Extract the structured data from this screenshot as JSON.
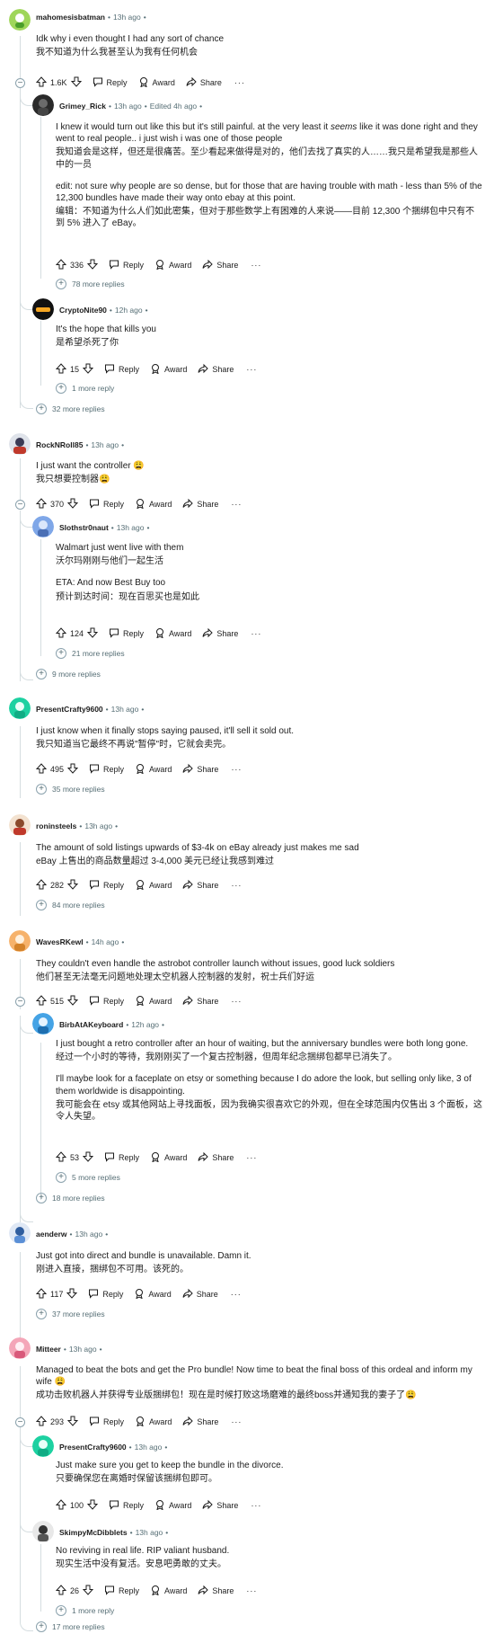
{
  "labels": {
    "reply": "Reply",
    "award": "Award",
    "share": "Share",
    "more": "···"
  },
  "comments": [
    {
      "user": "mahomesisbatman",
      "time": "13h ago",
      "text": "Idk why i even thought I had any sort of chance",
      "zh": "我不知道为什么我甚至认为我有任何机会",
      "votes": "1.6K"
    },
    {
      "user": "Grimey_Rick",
      "time": "13h ago",
      "edited": "Edited 4h ago",
      "text_a": "I knew it would turn out like this but it's still painful. at the very least it ",
      "text_em": "seems",
      "text_b": " like it was done right and they went to real people.. i just wish i was one of those people",
      "zh": "我知道会是这样，但还是很痛苦。至少看起来做得是对的，他们去找了真实的人……我只是希望我是那些人中的一员",
      "text2": "edit: not sure why people are so dense, but for those that are having trouble with math - less than 5% of the 12,300 bundles have made their way onto ebay at this point.",
      "zh2": "编辑：不知道为什么人们如此密集，但对于那些数学上有困难的人来说——目前 12,300 个捆绑包中只有不到 5% 进入了 eBay。",
      "votes": "336",
      "more_replies": "78 more replies"
    },
    {
      "user": "CryptoNite90",
      "time": "12h ago",
      "text": "It's the hope that kills you",
      "zh": "是希望杀死了你",
      "votes": "15",
      "more_replies": "1 more reply"
    },
    {
      "more_replies": "32 more replies"
    },
    {
      "user": "RockNRoll85",
      "time": "13h ago",
      "text": "I just want the controller 😩",
      "zh": "我只想要控制器😩",
      "votes": "370"
    },
    {
      "user": "Slothstr0naut",
      "time": "13h ago",
      "text": "Walmart just went live with them",
      "zh": "沃尔玛刚刚与他们一起生活",
      "text2": "ETA: And now Best Buy too",
      "zh2": "预计到达时间：现在百思买也是如此",
      "votes": "124",
      "more_replies": "21 more replies"
    },
    {
      "more_replies": "9 more replies"
    },
    {
      "user": "PresentCrafty9600",
      "time": "13h ago",
      "text": "I just know when it finally stops saying paused, it'll sell it sold out.",
      "zh": "我只知道当它最终不再说\"暂停\"时，它就会卖完。",
      "votes": "495",
      "more_replies": "35 more replies"
    },
    {
      "user": "roninsteels",
      "time": "13h ago",
      "text": "The amount of sold listings upwards of $3-4k on eBay already just makes me sad",
      "zh": "eBay 上售出的商品数量超过 3-4,000 美元已经让我感到难过",
      "votes": "282",
      "more_replies": "84 more replies"
    },
    {
      "user": "WavesRKewl",
      "time": "14h ago",
      "text": "They couldn't even handle the astrobot controller launch without issues, good luck soldiers",
      "zh": "他们甚至无法毫无问题地处理太空机器人控制器的发射，祝士兵们好运",
      "votes": "515"
    },
    {
      "user": "BirbAtAKeyboard",
      "time": "12h ago",
      "text": "I just bought a retro controller after an hour of waiting, but the anniversary bundles were both long gone.",
      "zh": "经过一个小时的等待，我刚刚买了一个复古控制器，但周年纪念捆绑包都早已消失了。",
      "text2": "I'll maybe look for a faceplate on etsy or something because I do adore the look, but selling only like, 3 of them worldwide is disappointing.",
      "zh2": "我可能会在 etsy 或其他网站上寻找面板，因为我确实很喜欢它的外观，但在全球范围内仅售出 3 个面板，这令人失望。",
      "votes": "53",
      "more_replies": "5 more replies"
    },
    {
      "more_replies": "18 more replies"
    },
    {
      "user": "aenderw",
      "time": "13h ago",
      "text": "Just got into direct and bundle is unavailable. Damn it.",
      "zh": "刚进入直接，捆绑包不可用。该死的。",
      "votes": "117",
      "more_replies": "37 more replies"
    },
    {
      "user": "Mitteer",
      "time": "13h ago",
      "text": "Managed to beat the bots and get the Pro bundle! Now time to beat the final boss of this ordeal and inform my wife 😩",
      "zh": "成功击败机器人并获得专业版捆绑包！现在是时候打败这场磨难的最终boss并通知我的妻子了😩",
      "votes": "293"
    },
    {
      "user": "PresentCrafty9600",
      "time": "13h ago",
      "text": "Just make sure you get to keep the bundle in the divorce.",
      "zh": "只要确保您在离婚时保留该捆绑包即可。",
      "votes": "100"
    },
    {
      "user": "SkimpyMcDibblets",
      "time": "13h ago",
      "text": "No reviving in real life. RIP valiant husband.",
      "zh": "现实生活中没有复活。安息吧勇敢的丈夫。",
      "votes": "26",
      "more_replies": "1 more reply"
    },
    {
      "more_replies": "17 more replies"
    }
  ]
}
